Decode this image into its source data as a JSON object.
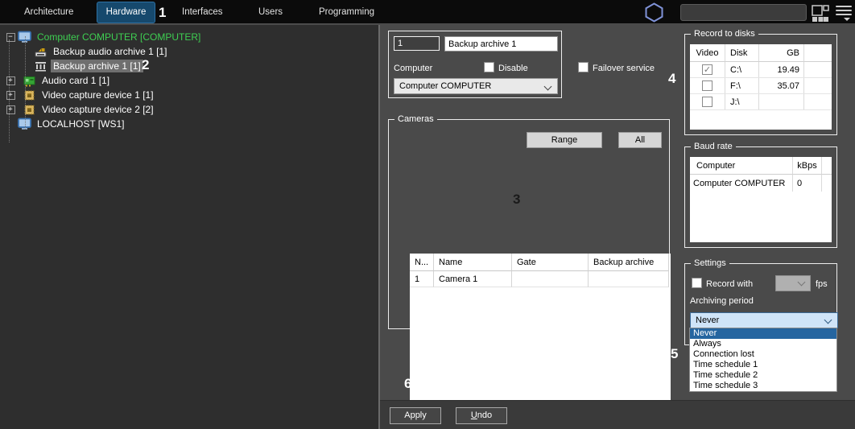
{
  "topbar": {
    "tabs": [
      {
        "label": "Architecture"
      },
      {
        "label": "Hardware",
        "active": true
      },
      {
        "label": "Interfaces"
      },
      {
        "label": "Users"
      },
      {
        "label": "Programming"
      }
    ],
    "search_value": ""
  },
  "tree": {
    "items": [
      {
        "label": "Computer COMPUTER [COMPUTER]",
        "icon": "computer",
        "expand": "minus",
        "color": "green"
      },
      {
        "label": "Backup audio archive 1 [1]",
        "icon": "backup-audio-archive",
        "depth": 1
      },
      {
        "label": "Backup archive 1 [1]",
        "icon": "backup-archive",
        "depth": 1,
        "selected": true
      },
      {
        "label": "Audio card 1 [1]",
        "icon": "audio-card",
        "depth": 1,
        "expand": "plus"
      },
      {
        "label": "Video capture device 1 [1]",
        "icon": "video-capture-device",
        "depth": 1,
        "expand": "plus"
      },
      {
        "label": "Video capture device 2 [2]",
        "icon": "video-capture-device",
        "depth": 1,
        "expand": "plus"
      },
      {
        "label": "LOCALHOST [WS1]",
        "icon": "computer"
      }
    ]
  },
  "editor": {
    "id_value": "1",
    "name_value": "Backup archive 1",
    "computer_label": "Computer",
    "disable_label": "Disable",
    "computer_value": "Computer COMPUTER",
    "failover_label": "Failover service"
  },
  "cameras": {
    "title": "Cameras",
    "range_button": "Range",
    "all_button": "All",
    "headers": [
      "N...",
      "Name",
      "Gate",
      "Backup archive"
    ],
    "rows": [
      [
        "1",
        "Camera 1",
        "",
        ""
      ]
    ]
  },
  "disks": {
    "title": "Record to disks",
    "headers": [
      "Video",
      "Disk",
      "GB"
    ],
    "rows": [
      {
        "checked": true,
        "disk": "C:\\",
        "gb": "19.49"
      },
      {
        "checked": false,
        "disk": "F:\\",
        "gb": "35.07"
      },
      {
        "checked": false,
        "disk": "J:\\",
        "gb": ""
      }
    ]
  },
  "baud": {
    "title": "Baud rate",
    "headers": [
      "Computer",
      "kBps"
    ],
    "rows": [
      [
        "Computer COMPUTER",
        "0"
      ]
    ]
  },
  "settings": {
    "title": "Settings",
    "record_with_label": "Record with",
    "fps_label": "fps",
    "archiving_label": "Archiving period",
    "archiving_value": "Never",
    "options": [
      "Never",
      "Always",
      "Connection lost",
      "Time schedule 1",
      "Time schedule 2",
      "Time schedule 3"
    ],
    "selected_option": "Never"
  },
  "actions": {
    "apply": "Apply",
    "undo_accel": "U",
    "undo_rest": "ndo"
  },
  "annotations": [
    "1",
    "2",
    "3",
    "4",
    "5",
    "6"
  ],
  "colors": {
    "active_tab": "#16496d",
    "tree_root_green": "#3ecf52",
    "selection_gray": "#6f6f6f",
    "dropdown_selected_blue": "#2565a0",
    "combo_bg": "#cfe4f8"
  }
}
